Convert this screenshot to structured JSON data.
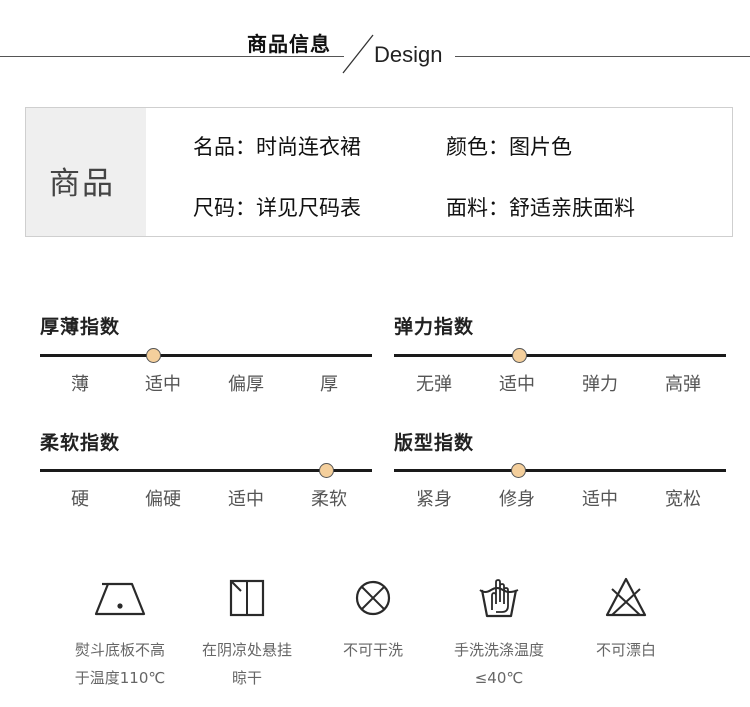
{
  "header": {
    "title": "商品信息",
    "subtitle": "Design"
  },
  "product": {
    "label": "商品",
    "fields": [
      {
        "key": "名品",
        "sep": "：",
        "value": "时尚连衣裙"
      },
      {
        "key": "颜色",
        "sep": "：",
        "value": "图片色"
      },
      {
        "key": "尺码",
        "sep": "：",
        "value": "详见尺码表"
      },
      {
        "key": "面料",
        "sep": "：",
        "value": "舒适亲肤面料"
      }
    ]
  },
  "indices": [
    {
      "title": "厚薄指数",
      "options": [
        "薄",
        "适中",
        "偏厚",
        "厚"
      ],
      "selected": 1
    },
    {
      "title": "弹力指数",
      "options": [
        "无弹",
        "适中",
        "弹力",
        "高弹"
      ],
      "selected": 1
    },
    {
      "title": "柔软指数",
      "options": [
        "硬",
        "偏硬",
        "适中",
        "柔软"
      ],
      "selected": 3
    },
    {
      "title": "版型指数",
      "options": [
        "紧身",
        "修身",
        "适中",
        "宽松"
      ],
      "selected": 1
    }
  ],
  "care": [
    {
      "icon": "iron-icon",
      "line1": "熨斗底板不高",
      "line2": "于温度110℃"
    },
    {
      "icon": "hang-dry-shade-icon",
      "line1": "在阴凉处悬挂",
      "line2": "晾干"
    },
    {
      "icon": "no-wash-icon",
      "line1": "不可干洗",
      "line2": ""
    },
    {
      "icon": "hand-wash-icon",
      "line1": "手洗洗涤温度",
      "line2": "≤40℃"
    },
    {
      "icon": "no-bleach-icon",
      "line1": "不可漂白",
      "line2": ""
    }
  ],
  "colors": {
    "knob": "#f4cf9c",
    "track": "#1a1a1a",
    "label_bg": "#efefef"
  }
}
